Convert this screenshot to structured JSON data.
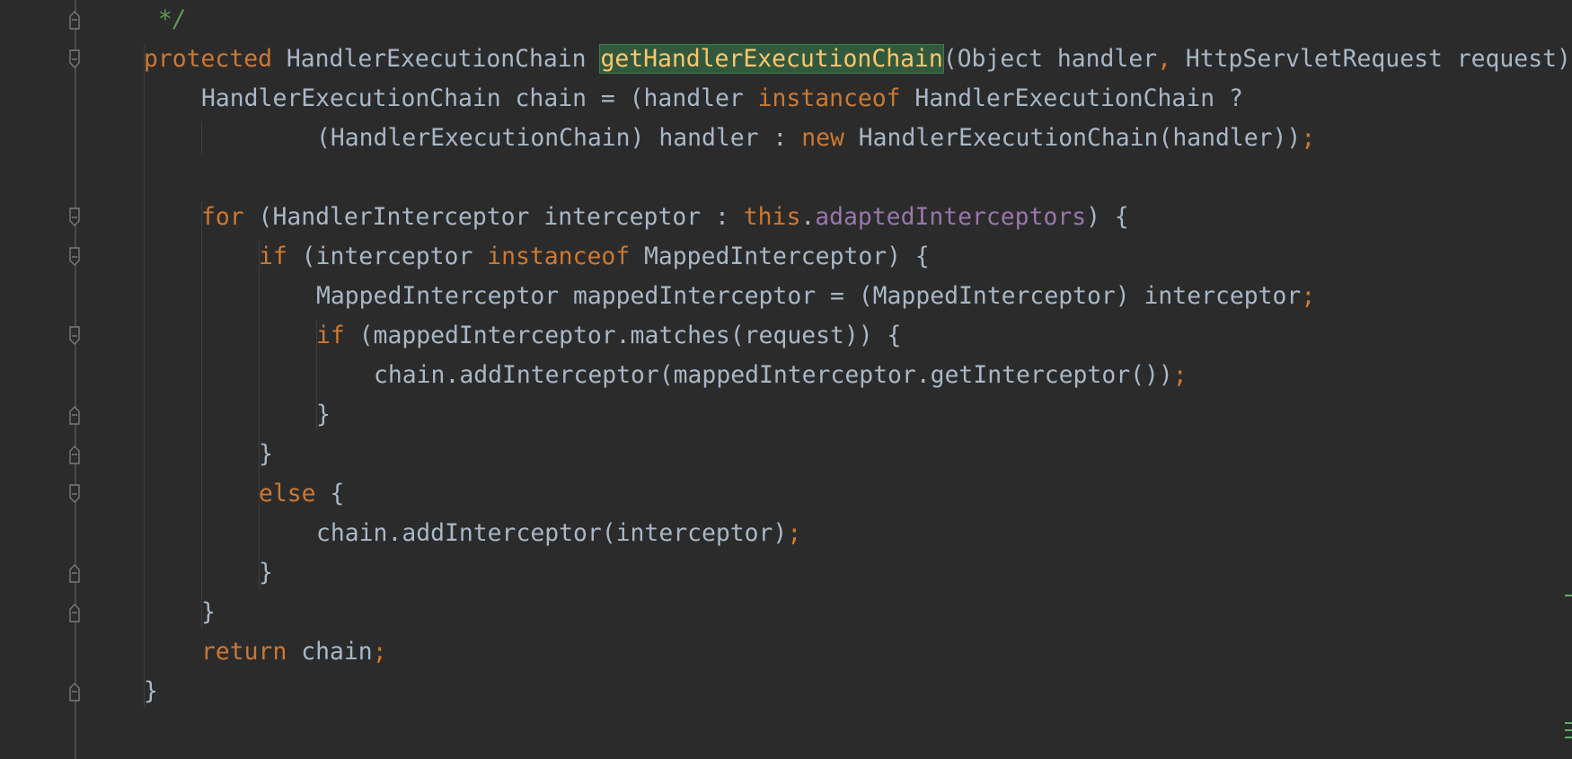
{
  "editor": {
    "language": "java",
    "colors": {
      "background": "#2b2b2b",
      "keyword": "#cc7832",
      "comment": "#629755",
      "field": "#9876aa",
      "text": "#a9b7c6",
      "highlight_bg": "#32593d",
      "highlight_text": "#ffc66d"
    },
    "lines": [
      {
        "indent": 1,
        "fold": "end",
        "tokens": [
          {
            "t": " */",
            "c": "comment"
          }
        ]
      },
      {
        "indent": 1,
        "fold": "start",
        "tokens": [
          {
            "t": "protected",
            "c": "kw"
          },
          {
            "t": " HandlerExecutionChain ",
            "c": "plain"
          },
          {
            "t": "getHandlerExecutionChain",
            "c": "highlight"
          },
          {
            "t": "(Object handler",
            "c": "plain"
          },
          {
            "t": ",",
            "c": "punct"
          },
          {
            "t": " HttpServletRequest request) {",
            "c": "plain"
          }
        ]
      },
      {
        "indent": 2,
        "fold": null,
        "tokens": [
          {
            "t": "HandlerExecutionChain chain = (handler ",
            "c": "plain"
          },
          {
            "t": "instanceof",
            "c": "kw"
          },
          {
            "t": " HandlerExecutionChain ?",
            "c": "plain"
          }
        ]
      },
      {
        "indent": 4,
        "fold": null,
        "tokens": [
          {
            "t": "(HandlerExecutionChain) handler : ",
            "c": "plain"
          },
          {
            "t": "new",
            "c": "kw"
          },
          {
            "t": " HandlerExecutionChain(handler))",
            "c": "plain"
          },
          {
            "t": ";",
            "c": "punct"
          }
        ]
      },
      {
        "indent": 0,
        "fold": null,
        "tokens": []
      },
      {
        "indent": 2,
        "fold": "start",
        "tokens": [
          {
            "t": "for",
            "c": "kw"
          },
          {
            "t": " (HandlerInterceptor interceptor : ",
            "c": "plain"
          },
          {
            "t": "this",
            "c": "kw"
          },
          {
            "t": ".",
            "c": "plain"
          },
          {
            "t": "adaptedInterceptors",
            "c": "field"
          },
          {
            "t": ") {",
            "c": "plain"
          }
        ]
      },
      {
        "indent": 3,
        "fold": "start",
        "tokens": [
          {
            "t": "if",
            "c": "kw"
          },
          {
            "t": " (interceptor ",
            "c": "plain"
          },
          {
            "t": "instanceof",
            "c": "kw"
          },
          {
            "t": " MappedInterceptor) {",
            "c": "plain"
          }
        ]
      },
      {
        "indent": 4,
        "fold": null,
        "tokens": [
          {
            "t": "MappedInterceptor mappedInterceptor = (MappedInterceptor) interceptor",
            "c": "plain"
          },
          {
            "t": ";",
            "c": "punct"
          }
        ]
      },
      {
        "indent": 4,
        "fold": "start",
        "tokens": [
          {
            "t": "if",
            "c": "kw"
          },
          {
            "t": " (mappedInterceptor.matches(request)) {",
            "c": "plain"
          }
        ]
      },
      {
        "indent": 5,
        "fold": null,
        "tokens": [
          {
            "t": "chain.addInterceptor(mappedInterceptor.getInterceptor())",
            "c": "plain"
          },
          {
            "t": ";",
            "c": "punct"
          }
        ]
      },
      {
        "indent": 4,
        "fold": "end",
        "tokens": [
          {
            "t": "}",
            "c": "plain"
          }
        ]
      },
      {
        "indent": 3,
        "fold": "end",
        "tokens": [
          {
            "t": "}",
            "c": "plain"
          }
        ]
      },
      {
        "indent": 3,
        "fold": "start",
        "tokens": [
          {
            "t": "else",
            "c": "kw"
          },
          {
            "t": " {",
            "c": "plain"
          }
        ]
      },
      {
        "indent": 4,
        "fold": null,
        "tokens": [
          {
            "t": "chain.addInterceptor(interceptor)",
            "c": "plain"
          },
          {
            "t": ";",
            "c": "punct"
          }
        ]
      },
      {
        "indent": 3,
        "fold": "end",
        "tokens": [
          {
            "t": "}",
            "c": "plain"
          }
        ]
      },
      {
        "indent": 2,
        "fold": "end",
        "tokens": [
          {
            "t": "}",
            "c": "plain"
          }
        ]
      },
      {
        "indent": 2,
        "fold": null,
        "tokens": [
          {
            "t": "return",
            "c": "kw"
          },
          {
            "t": " chain",
            "c": "plain"
          },
          {
            "t": ";",
            "c": "punct"
          }
        ]
      },
      {
        "indent": 1,
        "fold": "end",
        "tokens": [
          {
            "t": "}",
            "c": "plain"
          }
        ]
      }
    ]
  }
}
